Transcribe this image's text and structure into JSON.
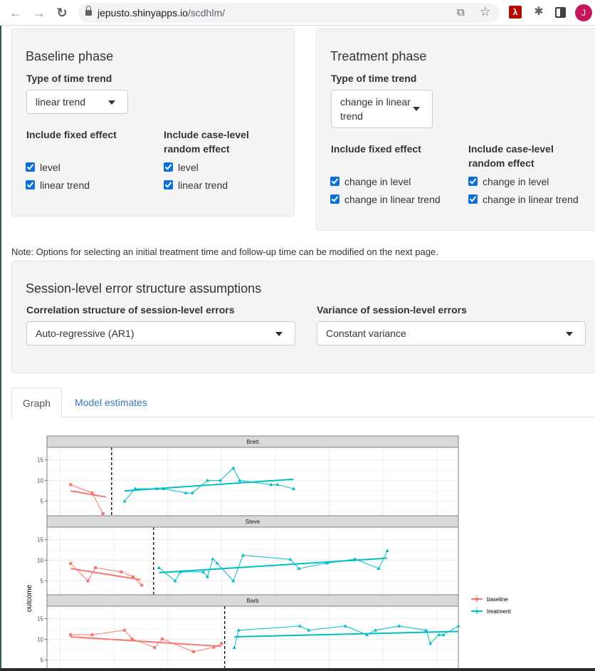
{
  "browser": {
    "url_host": "jepusto.shinyapps.io",
    "url_path": "/scdhlm/",
    "avatar_letter": "J",
    "icons": [
      "back-arrow-icon",
      "forward-arrow-icon",
      "reload-icon",
      "lock-icon",
      "share-icon",
      "star-icon",
      "pdf-extension-icon",
      "puzzle-extension-icon",
      "side-panel-icon"
    ]
  },
  "baseline": {
    "title": "Baseline phase",
    "trend_label": "Type of time trend",
    "trend_value": "linear trend",
    "fixed_label": "Include fixed effect",
    "random_label_1": "Include case-level",
    "random_label_2": "random effect",
    "fixed_options": [
      {
        "label": "level",
        "checked": true
      },
      {
        "label": "linear trend",
        "checked": true
      }
    ],
    "random_options": [
      {
        "label": "level",
        "checked": true
      },
      {
        "label": "linear trend",
        "checked": true
      }
    ]
  },
  "treatment": {
    "title": "Treatment phase",
    "trend_label": "Type of time trend",
    "trend_value_1": "change in linear",
    "trend_value_2": "trend",
    "fixed_label": "Include fixed effect",
    "random_label_1": "Include case-level",
    "random_label_2": "random effect",
    "fixed_options": [
      {
        "label": "change in level",
        "checked": true
      },
      {
        "label": "change in linear trend",
        "checked": true
      }
    ],
    "random_options": [
      {
        "label": "change in level",
        "checked": true
      },
      {
        "label": "change in linear trend",
        "checked": true
      }
    ]
  },
  "note": "Note: Options for selecting an initial treatment time and follow-up time can be modified on the next page.",
  "session": {
    "title": "Session-level error structure assumptions",
    "corr_label": "Correlation structure of session-level errors",
    "corr_value": "Auto-regressive (AR1)",
    "var_label": "Variance of session-level errors",
    "var_value": "Constant variance"
  },
  "tabs": [
    {
      "label": "Graph",
      "active": true
    },
    {
      "label": "Model estimates",
      "active": false
    }
  ],
  "chart_data": {
    "type": "line",
    "title": "",
    "xlabel": "",
    "ylabel": "outcome",
    "yticks": [
      5,
      10,
      15
    ],
    "ylim": [
      1.5,
      18
    ],
    "xlim": [
      -1.2,
      37
    ],
    "grid": true,
    "legend": {
      "placement": "right",
      "entries": [
        {
          "name": "baseline",
          "color": "#F8766D"
        },
        {
          "name": "treatment",
          "color": "#00BFC4"
        }
      ]
    },
    "panels": [
      {
        "name": "Brett",
        "phase_change": 4.8,
        "baseline": {
          "x": [
            1,
            3,
            4
          ],
          "y": [
            9,
            7,
            2
          ]
        },
        "baseline_fit": {
          "x": [
            1,
            4.3
          ],
          "y": [
            7.5,
            6
          ]
        },
        "treatment": {
          "x": [
            6,
            7,
            9,
            9.6,
            11.7,
            12.3,
            13.7,
            14.9,
            16.1,
            16.7,
            19.6,
            20.2,
            21.7
          ],
          "y": [
            5,
            8,
            8,
            8,
            7,
            7,
            10,
            10,
            13,
            10,
            9,
            9,
            8
          ]
        },
        "treatment_fit": {
          "x": [
            6,
            21.7
          ],
          "y": [
            7.5,
            10.3
          ]
        }
      },
      {
        "name": "Steve",
        "phase_change": 8.7,
        "baseline": {
          "x": [
            1,
            2.6,
            3.3,
            5.7,
            6.8,
            7.6
          ],
          "y": [
            9.2,
            5,
            8.2,
            7.2,
            6,
            4
          ]
        },
        "baseline_fit": {
          "x": [
            1,
            7.5
          ],
          "y": [
            8,
            5.3
          ]
        },
        "treatment": {
          "x": [
            9.2,
            10.7,
            11.2,
            13.3,
            13.7,
            14.2,
            14.6,
            16.1,
            17,
            21.4,
            22.2,
            24.8,
            27.4,
            29.6,
            30.4
          ],
          "y": [
            8.2,
            5,
            7.2,
            7.2,
            6,
            10.3,
            9.3,
            5,
            11.2,
            10.2,
            8,
            9.3,
            10.3,
            8,
            12.3
          ]
        },
        "treatment_fit": {
          "x": [
            9.2,
            30.4
          ],
          "y": [
            7,
            10.5
          ]
        }
      },
      {
        "name": "Barb",
        "phase_change": 15.3,
        "baseline": {
          "x": [
            1,
            3,
            6,
            6.7,
            8.8,
            9.5,
            12.4,
            14.3,
            15
          ],
          "y": [
            11.1,
            11.1,
            12.2,
            10.1,
            8,
            10.1,
            7,
            8.1,
            9
          ]
        },
        "baseline_fit": {
          "x": [
            1,
            15
          ],
          "y": [
            10.6,
            8.3
          ]
        },
        "treatment": {
          "x": [
            16.2,
            16.6,
            22.3,
            23.1,
            26.5,
            28.5,
            29.3,
            31.5,
            34,
            34.4,
            35.2,
            35.6,
            37
          ],
          "y": [
            8,
            12.2,
            13.2,
            12.2,
            13.2,
            11.1,
            12.2,
            13.2,
            12.2,
            9,
            11.1,
            11.1,
            13.2
          ]
        },
        "treatment_fit": {
          "x": [
            16.2,
            37
          ],
          "y": [
            10.6,
            11.9
          ]
        }
      }
    ]
  }
}
